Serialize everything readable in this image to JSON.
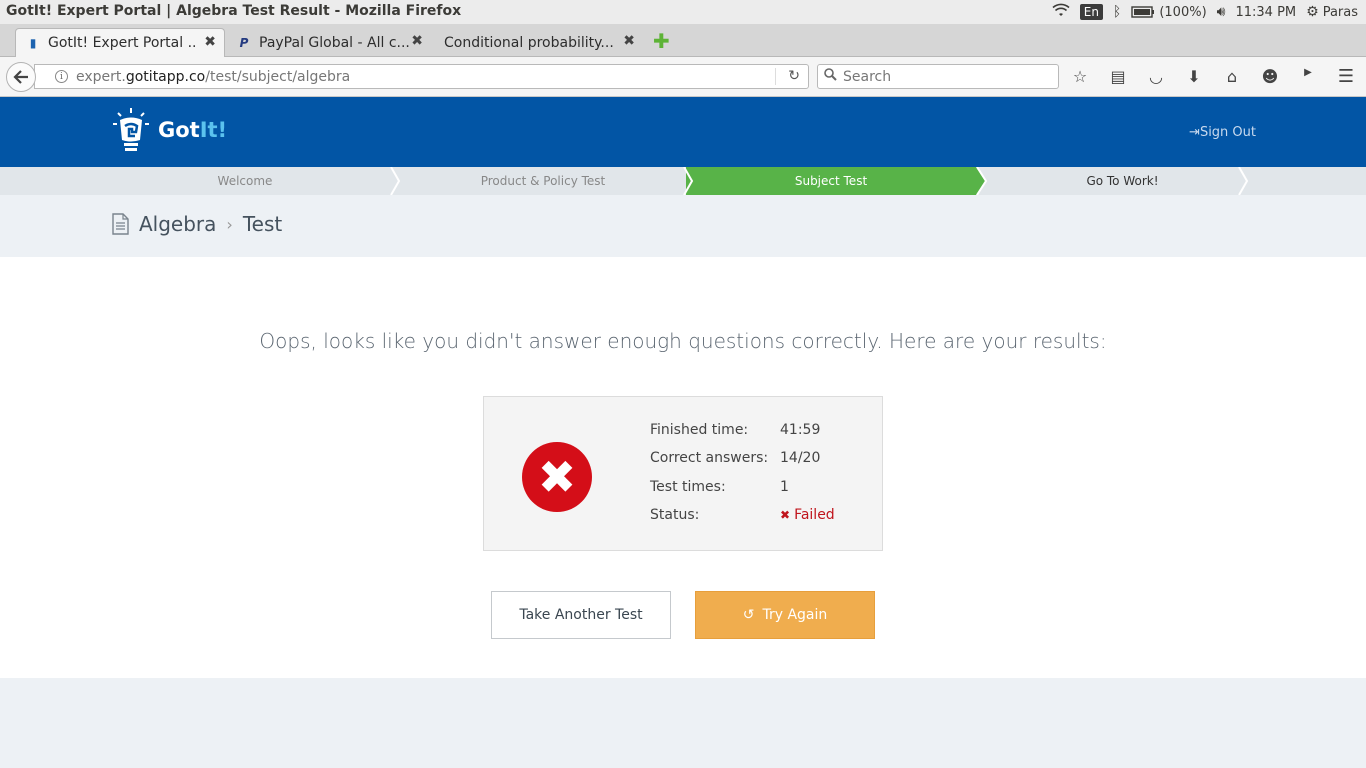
{
  "os": {
    "window_title": "GotIt! Expert Portal | Algebra Test Result - Mozilla Firefox",
    "lang": "En",
    "battery": "(100%)",
    "time": "11:34 PM",
    "user": "Paras"
  },
  "tabs": [
    {
      "label": "GotIt! Expert Portal ...",
      "favicon": "gotit-favicon"
    },
    {
      "label": "PayPal Global - All c...",
      "favicon": "paypal-favicon"
    },
    {
      "label": "Conditional probability...",
      "favicon": ""
    }
  ],
  "nav": {
    "url_prefix": "expert.",
    "url_domain": "gotitapp.co",
    "url_path": "/test/subject/algebra",
    "search_placeholder": "Search"
  },
  "header": {
    "logo_text_a": "Got",
    "logo_text_b": "It!",
    "signout": "Sign Out"
  },
  "steps": [
    {
      "label": "Welcome",
      "active": false
    },
    {
      "label": "Product & Policy Test",
      "active": false
    },
    {
      "label": "Subject Test",
      "active": true
    },
    {
      "label": "Go To Work!",
      "active": false
    }
  ],
  "breadcrumb": {
    "subject": "Algebra",
    "page": "Test"
  },
  "result": {
    "message": "Oops, looks like you didn't answer enough questions correctly. Here are your results:",
    "rows": [
      {
        "key": "Finished time:",
        "value": "41:59"
      },
      {
        "key": "Correct answers:",
        "value": "14/20"
      },
      {
        "key": "Test times:",
        "value": "1"
      },
      {
        "key": "Status:",
        "value": "Failed"
      }
    ]
  },
  "buttons": {
    "take_another": "Take Another Test",
    "try_again": "Try Again"
  },
  "colors": {
    "header_blue": "#0255a5",
    "step_active_green": "#58b348",
    "fail_red": "#d40e18",
    "try_again_orange": "#f0ad4e"
  }
}
